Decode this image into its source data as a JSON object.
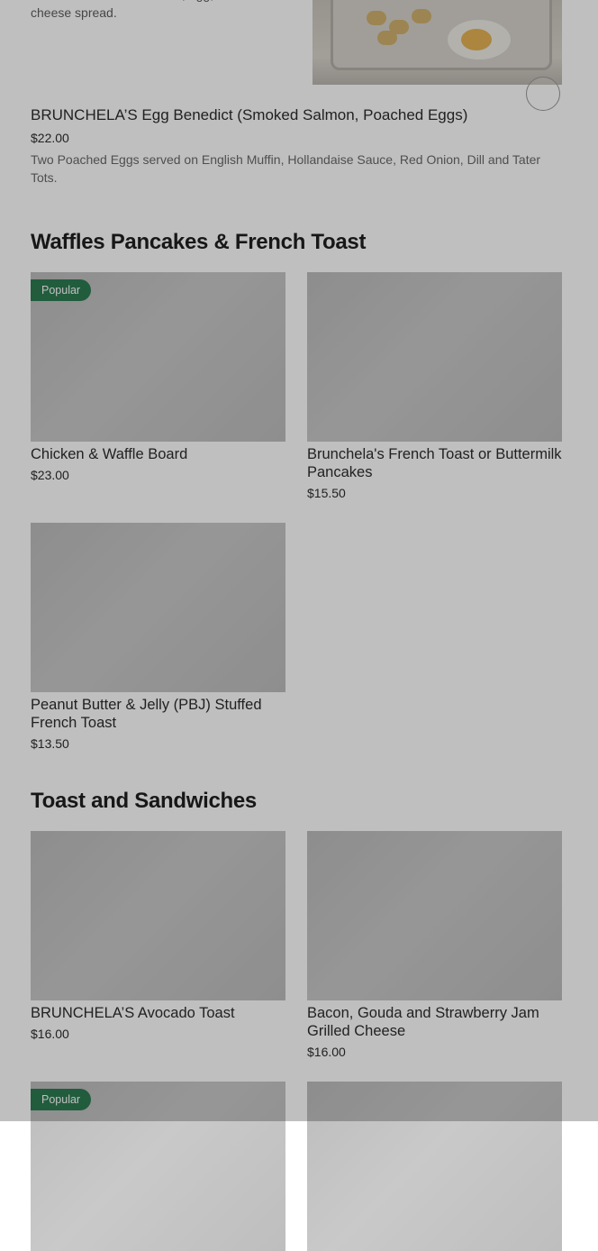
{
  "top_item": {
    "description": "Comes with fresh croissant, egg, and cream cheese spread."
  },
  "benedict": {
    "title": "BRUNCHELA’S Egg Benedict (Smoked Salmon, Poached Eggs)",
    "price": "$22.00",
    "description": "Two Poached Eggs served on English Muffin, Hollandaise Sauce, Red Onion, Dill and Tater Tots."
  },
  "sections": {
    "waffles": {
      "title": "Waffles Pancakes & French Toast",
      "items": [
        {
          "badge": "Popular",
          "title": "Chicken & Waffle Board",
          "price": "$23.00"
        },
        {
          "title": "Brunchela's French Toast or Buttermilk Pancakes",
          "price": "$15.50"
        },
        {
          "title": "Peanut Butter & Jelly (PBJ) Stuffed French Toast",
          "price": "$13.50"
        }
      ]
    },
    "toast": {
      "title": "Toast and Sandwiches",
      "items": [
        {
          "title": "BRUNCHELA’S Avocado Toast",
          "price": "$16.00"
        },
        {
          "title": "Bacon, Gouda and Strawberry Jam Grilled Cheese",
          "price": "$16.00"
        },
        {
          "badge": "Popular"
        }
      ]
    }
  },
  "colors": {
    "badge_bg": "#2d7b52",
    "scrim": "rgba(0,0,0,0.25)"
  }
}
